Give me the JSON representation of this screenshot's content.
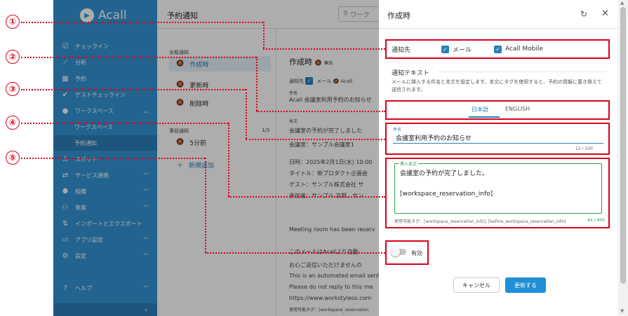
{
  "colors": {
    "brand": "#3394d3",
    "accent": "#1f8fd8",
    "annotation": "#d9001b",
    "success": "#2e9e4b"
  },
  "callouts": [
    "①",
    "②",
    "③",
    "④",
    "⑤"
  ],
  "sidebar": {
    "logo": "Acall",
    "items": [
      {
        "label": "チェックイン",
        "icon": "checkbox-icon"
      },
      {
        "label": "分析",
        "icon": "chart-icon"
      },
      {
        "label": "予約",
        "icon": "calendar-icon"
      },
      {
        "label": "ゲストチェックイン",
        "icon": "check-icon"
      },
      {
        "label": "ワークスペース",
        "icon": "location-icon"
      },
      {
        "label": "スポット",
        "icon": "spot-icon"
      },
      {
        "label": "サービス連携",
        "icon": "service-icon"
      },
      {
        "label": "組織",
        "icon": "group-icon"
      },
      {
        "label": "来客",
        "icon": "visitor-icon"
      },
      {
        "label": "インポートとエクスポート",
        "icon": "import-export-icon"
      },
      {
        "label": "アプリ設定",
        "icon": "app-icon"
      },
      {
        "label": "設定",
        "icon": "gear-icon"
      },
      {
        "label": "ヘルプ",
        "icon": "help-icon"
      }
    ],
    "subitems": [
      "ワークスペース",
      "予約通知"
    ]
  },
  "main": {
    "title": "予約通知",
    "search_placeholder": "ワーク",
    "sections": [
      {
        "label": "全般通知",
        "count": "",
        "items": [
          "作成時",
          "更新時",
          "削除時"
        ]
      },
      {
        "label": "事前通知",
        "count": "1/3",
        "items": [
          "5分前"
        ]
      }
    ],
    "add_label": "新規追加",
    "detail": {
      "title": "作成時",
      "badge": "無効",
      "notify_label": "通知先",
      "mail_label": "メール",
      "acall_label": "Acall",
      "subject_label": "件名",
      "subject_value": "Acall 会議室利用予約のお知らせ",
      "body_label": "本文",
      "lines": [
        "会議室の予約が完了しました",
        "会議室：サンプル会議室1",
        "日時：2025年2月1日(水) 10:00",
        "タイトル：新プロダクト企画会",
        "ゲスト：サンプル株式会社 サ",
        "参加者：サンプル 次郎、サン",
        "",
        "Meeting room has been reserv",
        "",
        "このメールはAcallより自動",
        "お心ご返信いただけませんの",
        "This is an automated email sent",
        "Please do not reply to this me",
        "https://www.workstyleos.com",
        "使用可能タグ：[workspace_reservation"
      ]
    }
  },
  "dialog": {
    "title": "作成時",
    "notify_label": "通知先",
    "mail_label": "メール",
    "acall_mobile_label": "Acall Mobile",
    "section_title": "通知テキスト",
    "description": "メールに挿入する件名と本文を設定します。本文にタグを使用すると、予約の情報に置き換えて送信されます。",
    "tabs": [
      "日本語",
      "ENGLISH"
    ],
    "subject_label": "件名",
    "subject_value": "会議室利用予約のお知らせ",
    "subject_count": "12 / 100",
    "body_label": "挿入本文",
    "body_line1": "会議室の予約が完了しました。",
    "body_line2": "[workspace_reservation_info]",
    "body_help": "使用可能タグ：[workspace_reservation_info], [before_workspace_reservation_info]",
    "body_count": "44 / 900",
    "toggle_label": "有効",
    "cancel_label": "キャンセル",
    "update_label": "更新する"
  }
}
